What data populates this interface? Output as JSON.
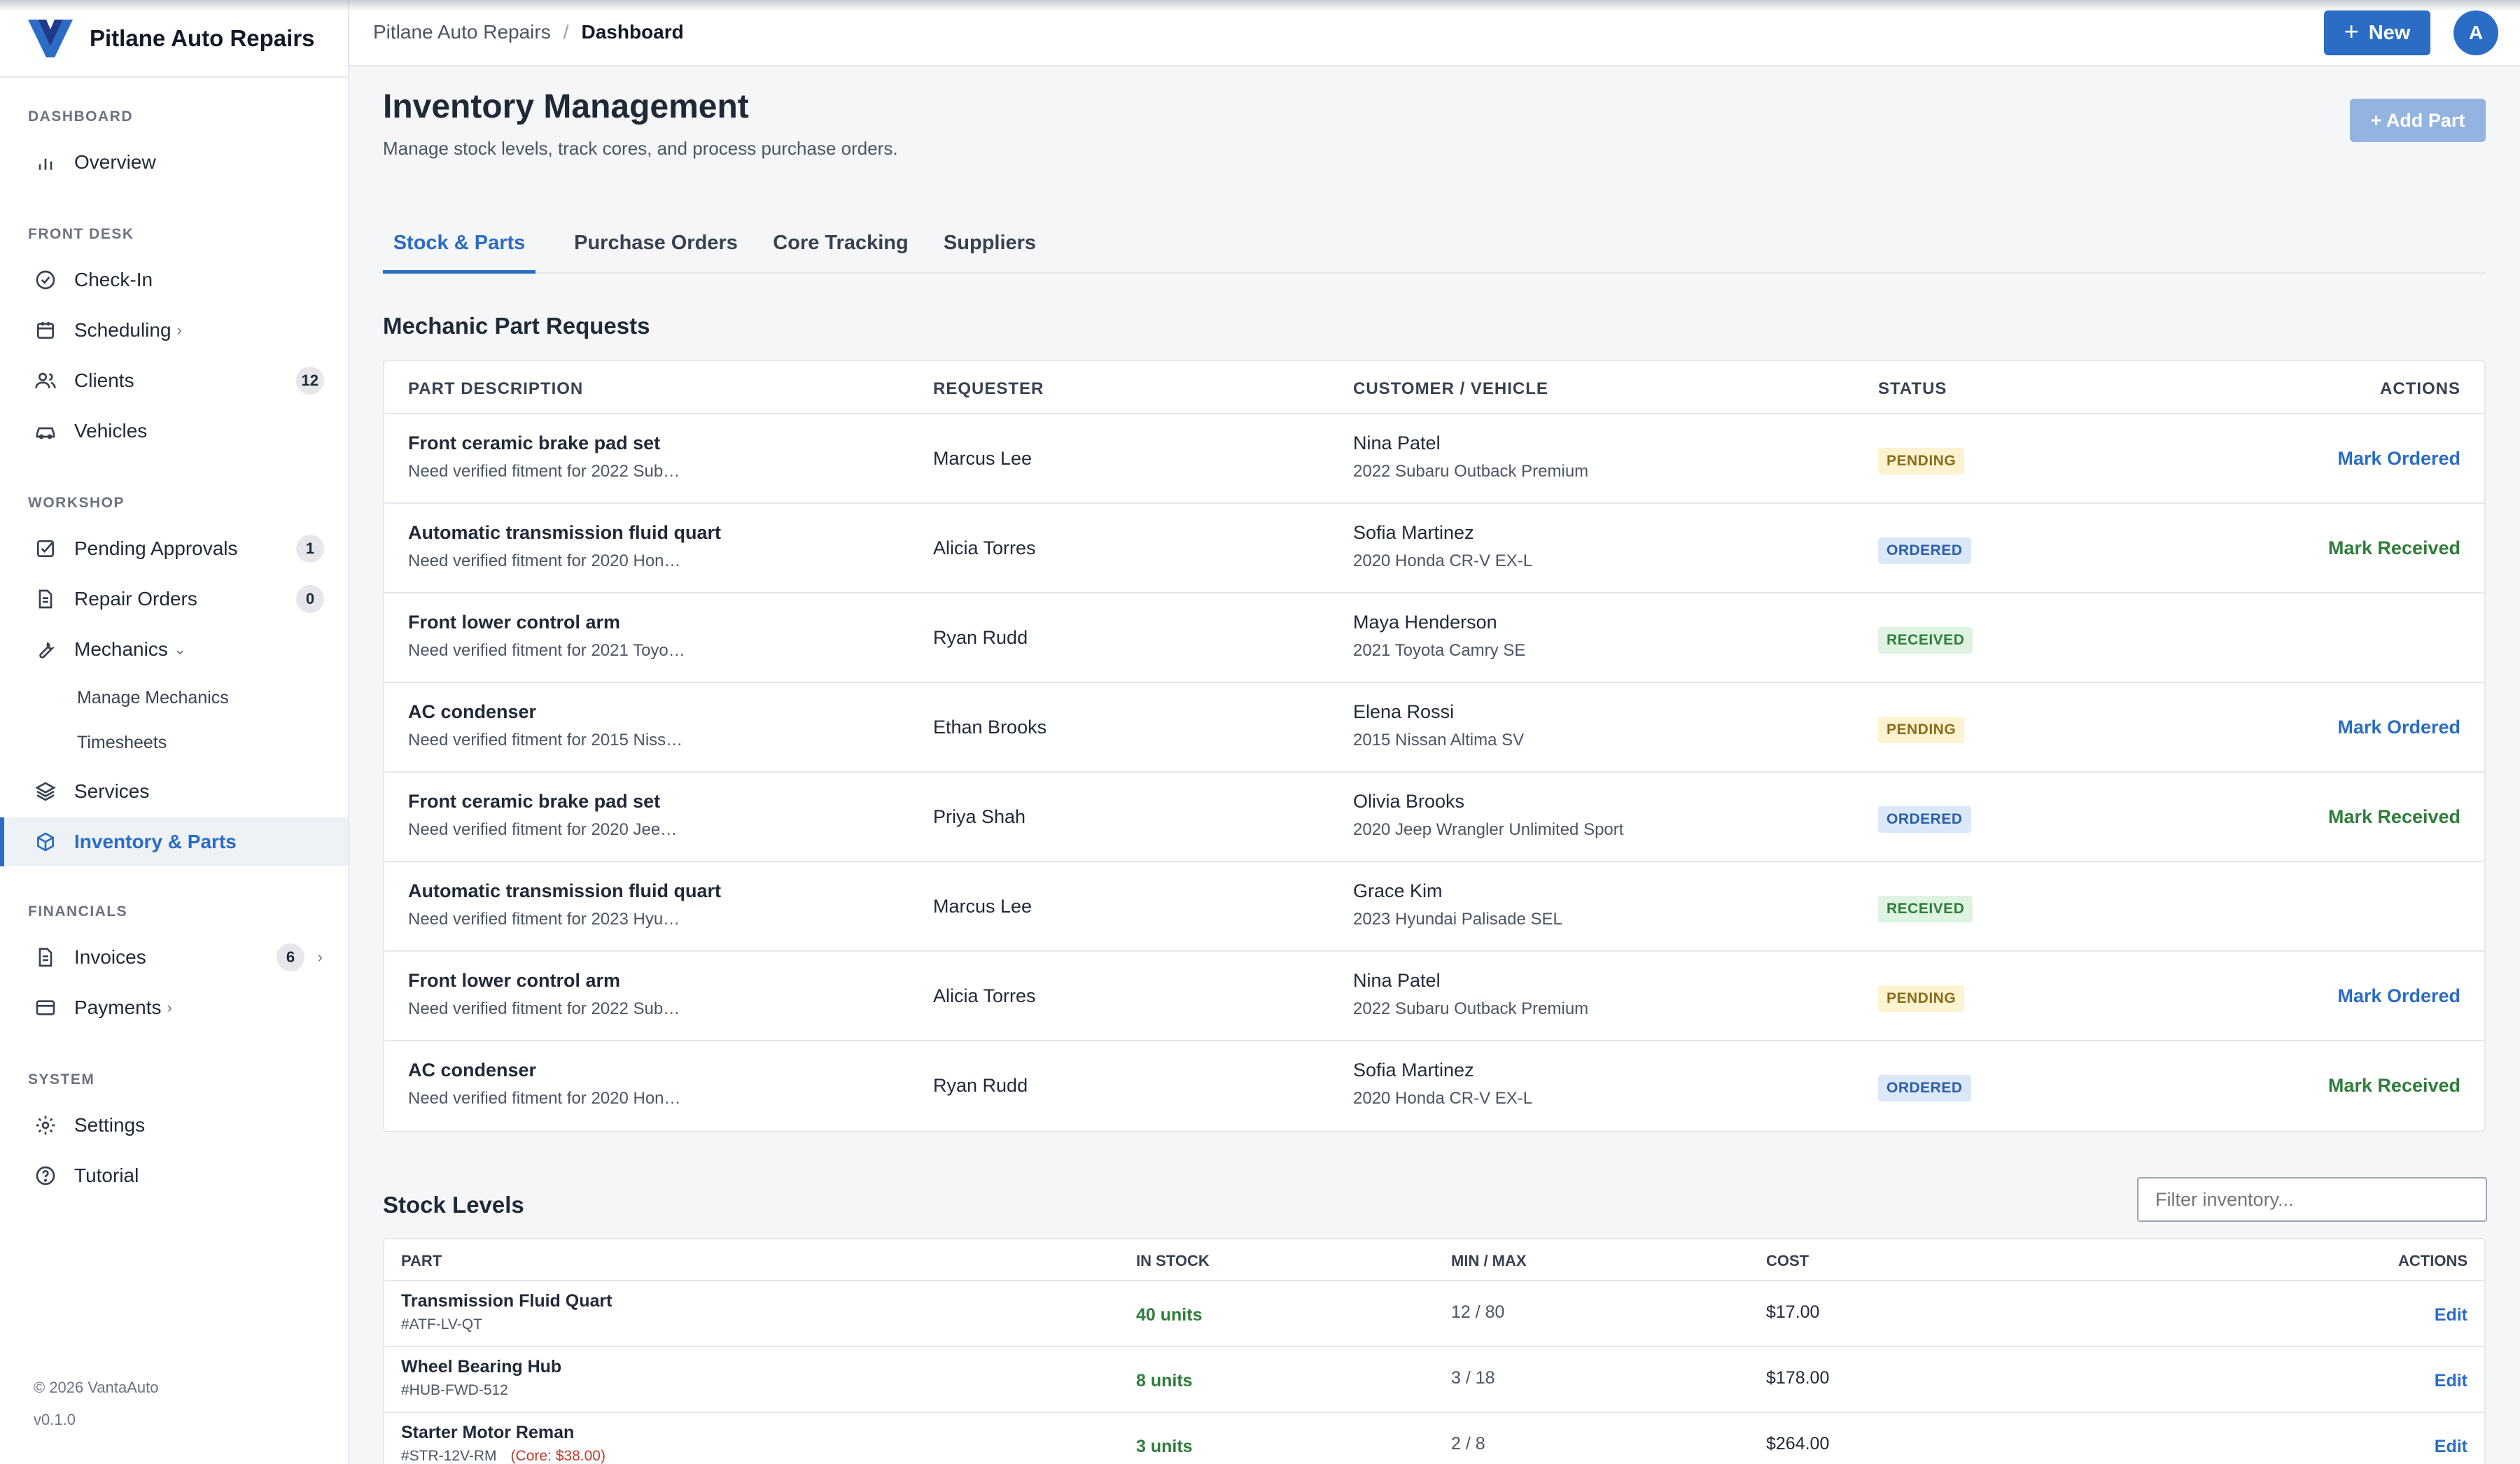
{
  "brand": {
    "name": "Pitlane Auto Repairs",
    "logo_icon": "v-chevron-logo-icon",
    "accent": "#2b6cc4"
  },
  "sidebar": {
    "sections": {
      "dashboard": "DASHBOARD",
      "front_desk": "FRONT DESK",
      "workshop": "WORKSHOP",
      "financials": "FINANCIALS",
      "system": "SYSTEM"
    },
    "items": {
      "overview": {
        "label": "Overview",
        "icon": "bar-chart-icon"
      },
      "checkin": {
        "label": "Check-In",
        "icon": "check-circle-icon"
      },
      "scheduling": {
        "label": "Scheduling",
        "icon": "calendar-icon"
      },
      "clients": {
        "label": "Clients",
        "icon": "users-icon",
        "badge": "12"
      },
      "vehicles": {
        "label": "Vehicles",
        "icon": "car-icon"
      },
      "pending": {
        "label": "Pending Approvals",
        "icon": "check-square-icon",
        "badge": "1"
      },
      "repair_orders": {
        "label": "Repair Orders",
        "icon": "document-icon",
        "badge": "0"
      },
      "mechanics": {
        "label": "Mechanics",
        "icon": "wrench-icon"
      },
      "manage_mechanics": {
        "label": "Manage Mechanics"
      },
      "timesheets": {
        "label": "Timesheets"
      },
      "services": {
        "label": "Services",
        "icon": "layers-icon"
      },
      "inventory": {
        "label": "Inventory & Parts",
        "icon": "box-icon"
      },
      "invoices": {
        "label": "Invoices",
        "icon": "document-icon",
        "badge": "6"
      },
      "payments": {
        "label": "Payments",
        "icon": "credit-card-icon"
      },
      "settings": {
        "label": "Settings",
        "icon": "gear-icon"
      },
      "tutorial": {
        "label": "Tutorial",
        "icon": "help-circle-icon"
      }
    },
    "footer": {
      "copyright": "© 2026 VantaAuto",
      "version": "v0.1.0"
    }
  },
  "header": {
    "breadcrumb_root": "Pitlane Auto Repairs",
    "breadcrumb_sep": "/",
    "breadcrumb_current": "Dashboard",
    "new_label": "New",
    "avatar_initial": "A"
  },
  "page": {
    "title": "Inventory Management",
    "subtitle": "Manage stock levels, track cores, and process purchase orders.",
    "add_part_label": "+ Add Part",
    "tabs": [
      "Stock & Parts",
      "Purchase Orders",
      "Core Tracking",
      "Suppliers"
    ]
  },
  "requests": {
    "title": "Mechanic Part Requests",
    "columns": [
      "PART DESCRIPTION",
      "REQUESTER",
      "CUSTOMER / VEHICLE",
      "STATUS",
      "ACTIONS"
    ],
    "rows": [
      {
        "part": "Front ceramic brake pad set",
        "note": "Need verified fitment for 2022 Sub…",
        "requester": "Marcus Lee",
        "customer": "Nina Patel",
        "vehicle": "2022 Subaru Outback Premium",
        "status": "PENDING",
        "action": "Mark Ordered"
      },
      {
        "part": "Automatic transmission fluid quart",
        "note": "Need verified fitment for 2020 Hon…",
        "requester": "Alicia Torres",
        "customer": "Sofia Martinez",
        "vehicle": "2020 Honda CR-V EX-L",
        "status": "ORDERED",
        "action": "Mark Received"
      },
      {
        "part": "Front lower control arm",
        "note": "Need verified fitment for 2021 Toyo…",
        "requester": "Ryan Rudd",
        "customer": "Maya Henderson",
        "vehicle": "2021 Toyota Camry SE",
        "status": "RECEIVED",
        "action": ""
      },
      {
        "part": "AC condenser",
        "note": "Need verified fitment for 2015 Niss…",
        "requester": "Ethan Brooks",
        "customer": "Elena Rossi",
        "vehicle": "2015 Nissan Altima SV",
        "status": "PENDING",
        "action": "Mark Ordered"
      },
      {
        "part": "Front ceramic brake pad set",
        "note": "Need verified fitment for 2020 Jee…",
        "requester": "Priya Shah",
        "customer": "Olivia Brooks",
        "vehicle": "2020 Jeep Wrangler Unlimited Sport",
        "status": "ORDERED",
        "action": "Mark Received"
      },
      {
        "part": "Automatic transmission fluid quart",
        "note": "Need verified fitment for 2023 Hyu…",
        "requester": "Marcus Lee",
        "customer": "Grace Kim",
        "vehicle": "2023 Hyundai Palisade SEL",
        "status": "RECEIVED",
        "action": ""
      },
      {
        "part": "Front lower control arm",
        "note": "Need verified fitment for 2022 Sub…",
        "requester": "Alicia Torres",
        "customer": "Nina Patel",
        "vehicle": "2022 Subaru Outback Premium",
        "status": "PENDING",
        "action": "Mark Ordered"
      },
      {
        "part": "AC condenser",
        "note": "Need verified fitment for 2020 Hon…",
        "requester": "Ryan Rudd",
        "customer": "Sofia Martinez",
        "vehicle": "2020 Honda CR-V EX-L",
        "status": "ORDERED",
        "action": "Mark Received"
      }
    ]
  },
  "stock": {
    "title": "Stock Levels",
    "filter_placeholder": "Filter inventory...",
    "columns": [
      "PART",
      "IN STOCK",
      "MIN / MAX",
      "COST",
      "ACTIONS"
    ],
    "rows": [
      {
        "name": "Transmission Fluid Quart",
        "sku": "#ATF-LV-QT",
        "core": "",
        "in_stock": "40 units",
        "minmax": "12 / 80",
        "cost": "$17.00",
        "action": "Edit"
      },
      {
        "name": "Wheel Bearing Hub",
        "sku": "#HUB-FWD-512",
        "core": "",
        "in_stock": "8 units",
        "minmax": "3 / 18",
        "cost": "$178.00",
        "action": "Edit"
      },
      {
        "name": "Starter Motor Reman",
        "sku": "#STR-12V-RM",
        "core": "(Core: $38.00)",
        "in_stock": "3 units",
        "minmax": "2 / 8",
        "cost": "$264.00",
        "action": "Edit"
      }
    ]
  }
}
